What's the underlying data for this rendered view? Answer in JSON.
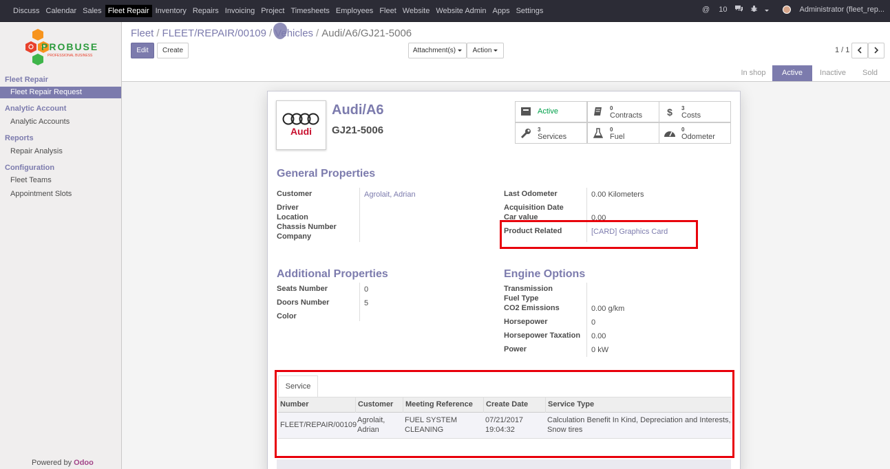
{
  "topbar": {
    "menu": [
      "Discuss",
      "Calendar",
      "Sales",
      "Fleet Repair",
      "Inventory",
      "Repairs",
      "Invoicing",
      "Project",
      "Timesheets",
      "Employees",
      "Fleet",
      "Website",
      "Website Admin",
      "Apps",
      "Settings"
    ],
    "active_menu": "Fleet Repair",
    "messages_count": "10",
    "user": "Administrator (fleet_rep..."
  },
  "sidebar": {
    "logo_text": "PROBUSE",
    "logo_subtext": "PROFESSIONAL BUSINESS",
    "sections": [
      {
        "title": "Fleet Repair",
        "items": [
          "Fleet Repair Request"
        ]
      },
      {
        "title": "Analytic Account",
        "items": [
          "Analytic Accounts"
        ]
      },
      {
        "title": "Reports",
        "items": [
          "Repair Analysis"
        ]
      },
      {
        "title": "Configuration",
        "items": [
          "Fleet Teams",
          "Appointment Slots"
        ]
      }
    ],
    "powered_by": "Powered by",
    "powered_brand": "Odoo"
  },
  "breadcrumb": {
    "items": [
      "Fleet",
      "FLEET/REPAIR/00109",
      "Vehicles"
    ],
    "current": "Audi/A6/GJ21-5006",
    "sep": "/"
  },
  "buttons": {
    "edit": "Edit",
    "create": "Create",
    "attachments": "Attachment(s)",
    "action": "Action"
  },
  "pager": {
    "text": "1 / 1"
  },
  "statusbar": {
    "stages": [
      "In shop",
      "Active",
      "Inactive",
      "Sold"
    ],
    "active": "Active"
  },
  "vehicle": {
    "brand_logo_text": "Audi",
    "model": "Audi/A6",
    "plate": "GJ21-5006"
  },
  "stat_buttons": [
    {
      "label": "Active",
      "number": "",
      "icon": "active-doc-icon"
    },
    {
      "label": "Contracts",
      "number": "0",
      "icon": "book-icon"
    },
    {
      "label": "Costs",
      "number": "3",
      "icon": "dollar-icon"
    },
    {
      "label": "Services",
      "number": "3",
      "icon": "wrench-icon"
    },
    {
      "label": "Fuel",
      "number": "0",
      "icon": "flask-icon"
    },
    {
      "label": "Odometer",
      "number": "0",
      "icon": "tachometer-icon"
    }
  ],
  "general": {
    "title": "General Properties",
    "customer_label": "Customer",
    "customer": "Agrolait, Adrian",
    "driver_label": "Driver",
    "location_label": "Location",
    "chassis_label": "Chassis Number",
    "company_label": "Company",
    "odometer_label": "Last Odometer",
    "odometer_value": "0.00",
    "odometer_unit": "Kilometers",
    "acq_label": "Acquisition Date",
    "car_value_label": "Car value",
    "car_value": "0.00",
    "product_label": "Product Related",
    "product": "[CARD] Graphics Card"
  },
  "additional": {
    "title": "Additional Properties",
    "seats_label": "Seats Number",
    "seats": "0",
    "doors_label": "Doors Number",
    "doors": "5",
    "color_label": "Color"
  },
  "engine": {
    "title": "Engine Options",
    "transmission_label": "Transmission",
    "fuel_label": "Fuel Type",
    "co2_label": "CO2 Emissions",
    "co2": "0.00",
    "co2_unit": "g/km",
    "hp_label": "Horsepower",
    "hp": "0",
    "hp_tax_label": "Horsepower Taxation",
    "hp_tax": "0.00",
    "power_label": "Power",
    "power": "0",
    "power_unit": "kW"
  },
  "service_tab": {
    "tab_label": "Service",
    "columns": [
      "Number",
      "Customer",
      "Meeting Reference",
      "Create Date",
      "Service Type"
    ],
    "rows": [
      {
        "number": "FLEET/REPAIR/00109",
        "customer_l1": "Agrolait,",
        "customer_l2": "Adrian",
        "meeting_l1": "FUEL SYSTEM",
        "meeting_l2": "CLEANING",
        "date_l1": "07/21/2017",
        "date_l2": "19:04:32",
        "service_l1": "Calculation Benefit In Kind, Depreciation and Interests,",
        "service_l2": "Snow tires"
      }
    ]
  }
}
